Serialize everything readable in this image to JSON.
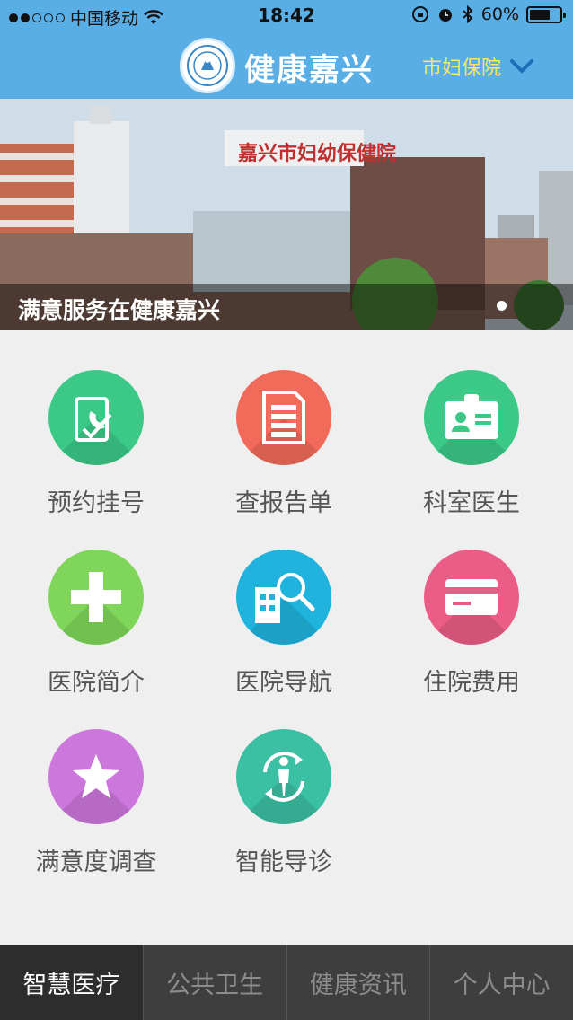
{
  "status_bar": {
    "carrier": "中国移动",
    "time": "18:42",
    "battery": "60%"
  },
  "header": {
    "title": "健康嘉兴",
    "hospital": "市妇保院"
  },
  "banner": {
    "caption": "满意服务在健康嘉兴",
    "building_sign": "嘉兴市妇幼保健院"
  },
  "tiles": [
    {
      "label": "预约挂号",
      "icon": "phone-document-icon",
      "color": "#3cc987"
    },
    {
      "label": "查报告单",
      "icon": "report-list-icon",
      "color": "#f26b5a"
    },
    {
      "label": "科室医生",
      "icon": "doctor-id-card-icon",
      "color": "#3cc987"
    },
    {
      "label": "医院简介",
      "icon": "plus-icon",
      "color": "#7fd65a"
    },
    {
      "label": "医院导航",
      "icon": "hospital-search-icon",
      "color": "#1fb3dd"
    },
    {
      "label": "住院费用",
      "icon": "credit-card-icon",
      "color": "#ea5d86"
    },
    {
      "label": "满意度调查",
      "icon": "star-icon",
      "color": "#cc77db"
    },
    {
      "label": "智能导诊",
      "icon": "person-rotate-icon",
      "color": "#3cc0a3"
    }
  ],
  "tabbar": [
    {
      "label": "智慧医疗",
      "active": true
    },
    {
      "label": "公共卫生",
      "active": false
    },
    {
      "label": "健康资讯",
      "active": false
    },
    {
      "label": "个人中心",
      "active": false
    }
  ]
}
